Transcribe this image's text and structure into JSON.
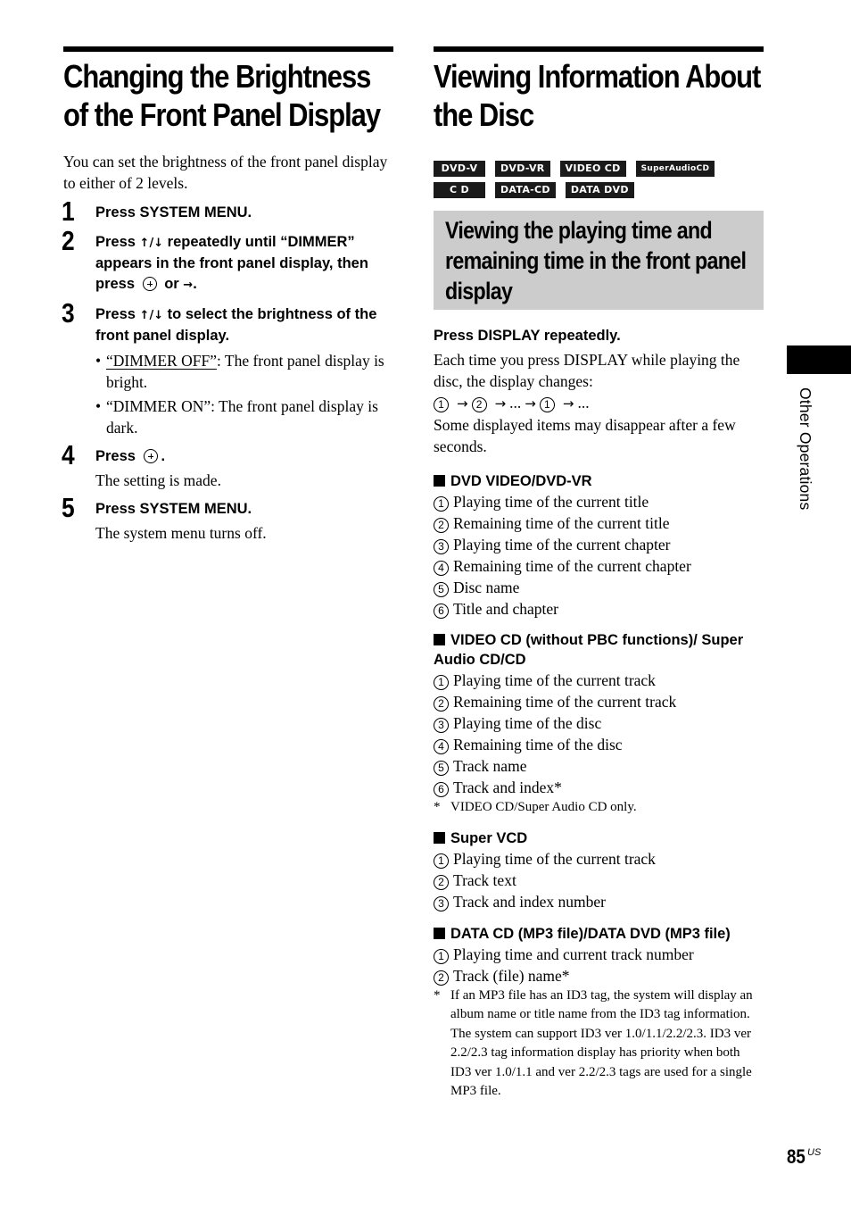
{
  "left": {
    "title": "Changing the Brightness of the Front Panel Display",
    "intro": "You can set the brightness of the front panel display to either of 2 levels.",
    "steps": [
      {
        "num": "1",
        "head": "Press SYSTEM MENU."
      },
      {
        "num": "2",
        "head_a": "Press ",
        "head_arrows": "↑/↓",
        "head_b": " repeatedly until “DIMMER” appears in the front panel display, then press ",
        "head_or": " or ",
        "head_right": "→",
        "head_end": "."
      },
      {
        "num": "3",
        "head_a": "Press ",
        "head_arrows": "↑/↓",
        "head_b": " to select the brightness of the front panel display.",
        "bullets": [
          {
            "term": "“DIMMER OFF”",
            "text": ": The front panel display is bright."
          },
          {
            "term": "“DIMMER ON”",
            "text": ": The front panel display is dark."
          }
        ]
      },
      {
        "num": "4",
        "head_a": "Press ",
        "head_end": ".",
        "desc": "The setting is made."
      },
      {
        "num": "5",
        "head": "Press SYSTEM MENU.",
        "desc": "The system menu turns off."
      }
    ]
  },
  "right": {
    "title": "Viewing Information About the Disc",
    "badges": [
      "DVD-V",
      "DVD-VR",
      "VIDEO CD",
      "SuperAudioCD",
      "C D",
      "DATA-CD",
      "DATA DVD"
    ],
    "subhead": "Viewing the playing time and remaining time in the front panel display",
    "lead": "Press DISPLAY repeatedly.",
    "para1": "Each time you press DISPLAY while playing the disc, the display changes:",
    "sequence": {
      "a": "1",
      "b": "2",
      "c": "1",
      "dots": "...",
      "arrow": "→"
    },
    "para2": "Some displayed items may disappear after a few seconds.",
    "sections": [
      {
        "head": "DVD VIDEO/DVD-VR",
        "items": [
          {
            "n": "1",
            "text": "Playing time of the current title"
          },
          {
            "n": "2",
            "text": "Remaining time of the current title"
          },
          {
            "n": "3",
            "text": "Playing time of the current chapter"
          },
          {
            "n": "4",
            "text": "Remaining time of the current chapter"
          },
          {
            "n": "5",
            "text": "Disc name"
          },
          {
            "n": "6",
            "text": "Title and chapter"
          }
        ]
      },
      {
        "head": "VIDEO CD (without PBC functions)/ Super Audio CD/CD",
        "items": [
          {
            "n": "1",
            "text": "Playing time of the current track"
          },
          {
            "n": "2",
            "text": "Remaining time of the current track"
          },
          {
            "n": "3",
            "text": "Playing time of the disc"
          },
          {
            "n": "4",
            "text": "Remaining time of the disc"
          },
          {
            "n": "5",
            "text": "Track name"
          },
          {
            "n": "6",
            "text": "Track and index*"
          }
        ],
        "footnote_star": "*",
        "footnote": "VIDEO CD/Super Audio CD only."
      },
      {
        "head": "Super VCD",
        "items": [
          {
            "n": "1",
            "text": "Playing time of the current track"
          },
          {
            "n": "2",
            "text": "Track text"
          },
          {
            "n": "3",
            "text": "Track and index number"
          }
        ]
      },
      {
        "head": "DATA CD (MP3 file)/DATA DVD (MP3 file)",
        "items": [
          {
            "n": "1",
            "text": "Playing time and current track number"
          },
          {
            "n": "2",
            "text": "Track (file) name*"
          }
        ],
        "footnote_star": "*",
        "footnote": "If an MP3 file has an ID3 tag, the system will display an album name or title name from the ID3 tag information.",
        "footnote2": "The system can support ID3 ver 1.0/1.1/2.2/2.3. ID3 ver 2.2/2.3 tag information display has priority when both ID3 ver 1.0/1.1 and ver 2.2/2.3 tags are used for a single MP3 file."
      }
    ]
  },
  "side_tab": {
    "label": "Other Operations"
  },
  "page": {
    "number": "85",
    "region": "US"
  },
  "icons": {
    "bullet": "•"
  }
}
